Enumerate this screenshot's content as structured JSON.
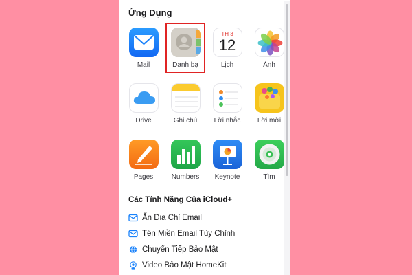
{
  "section_title": "Ứng Dụng",
  "apps": [
    {
      "label": "Mail",
      "icon": "mail-icon"
    },
    {
      "label": "Danh bạ",
      "icon": "contacts-icon"
    },
    {
      "label": "Lịch",
      "icon": "calendar-icon",
      "weekday": "TH 3",
      "day": "12"
    },
    {
      "label": "Ảnh",
      "icon": "photos-icon"
    },
    {
      "label": "Drive",
      "icon": "icloud-drive-icon"
    },
    {
      "label": "Ghi chú",
      "icon": "notes-icon"
    },
    {
      "label": "Lời nhắc",
      "icon": "reminders-icon"
    },
    {
      "label": "Lời mời",
      "icon": "invites-icon"
    },
    {
      "label": "Pages",
      "icon": "pages-icon"
    },
    {
      "label": "Numbers",
      "icon": "numbers-icon"
    },
    {
      "label": "Keynote",
      "icon": "keynote-icon"
    },
    {
      "label": "Tìm",
      "icon": "find-my-icon"
    }
  ],
  "features_title": "Các Tính Năng Của iCloud+",
  "features": [
    {
      "label": "Ẩn Địa Chỉ Email",
      "icon": "envelope-icon"
    },
    {
      "label": "Tên Miền Email Tùy Chỉnh",
      "icon": "envelope-icon"
    },
    {
      "label": "Chuyển Tiếp Bảo Mật",
      "icon": "globe-icon"
    },
    {
      "label": "Video Bảo Mật HomeKit",
      "icon": "camera-icon"
    }
  ],
  "colors": {
    "background": "#ff8fa3",
    "highlight_border": "#e02424",
    "accent": "#1a82fb"
  }
}
